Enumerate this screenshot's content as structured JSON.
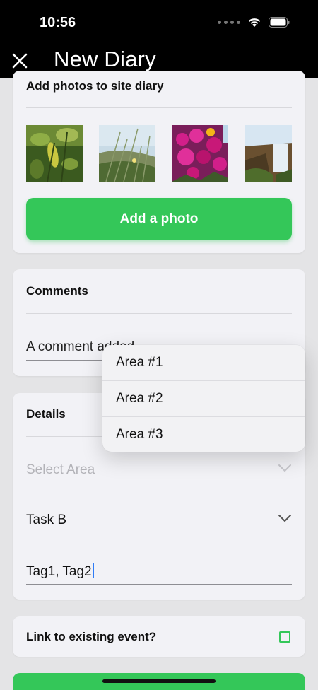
{
  "status_bar": {
    "time": "10:56"
  },
  "nav": {
    "title": "New Diary"
  },
  "photos": {
    "title": "Add photos to site diary",
    "thumbnails": [
      "plant-photo",
      "grass-photo",
      "flowers-photo",
      "waterfall-photo"
    ],
    "add_button_label": "Add a photo"
  },
  "comments": {
    "title": "Comments",
    "value": "A comment added"
  },
  "details": {
    "title": "Details",
    "area_placeholder": "Select Area",
    "task_value": "Task B",
    "tags_value": "Tag1, Tag2"
  },
  "link_event": {
    "label": "Link to existing event?",
    "checked": false
  },
  "area_menu": {
    "options": [
      "Area #1",
      "Area #2",
      "Area #3"
    ]
  },
  "colors": {
    "accent_green": "#34c759",
    "header_bg": "#000000",
    "card_bg": "#f2f2f6"
  }
}
